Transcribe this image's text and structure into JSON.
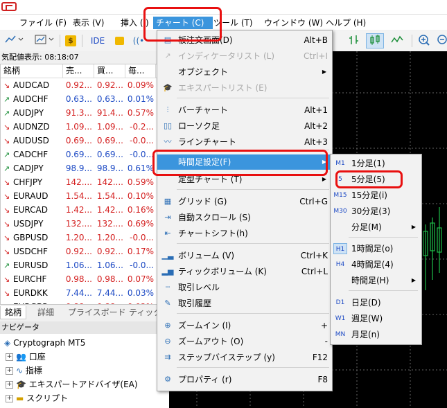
{
  "menubar": {
    "items": [
      {
        "label": "ファイル (F)"
      },
      {
        "label": "表示 (V)"
      },
      {
        "label": "挿入 (I)"
      },
      {
        "label": "チャート (C)"
      },
      {
        "label": "ツール (T)"
      },
      {
        "label": "ウインドウ (W)"
      },
      {
        "label": "ヘルプ (H)"
      }
    ]
  },
  "toolbar": {
    "ide_label": "IDE"
  },
  "market_watch": {
    "header": "気配値表示: 08:18:07",
    "columns": [
      "銘柄",
      "売...",
      "買...",
      "毎..."
    ],
    "rows": [
      {
        "dir": "down",
        "symbol": "AUDCAD",
        "bid": "0.92...",
        "ask": "0.92...",
        "change": "0.09%",
        "color": "red"
      },
      {
        "dir": "up",
        "symbol": "AUDCHF",
        "bid": "0.63...",
        "ask": "0.63...",
        "change": "0.01%",
        "color": "blue"
      },
      {
        "dir": "up",
        "symbol": "AUDJPY",
        "bid": "91.3...",
        "ask": "91.4...",
        "change": "0.57%",
        "color": "red"
      },
      {
        "dir": "down",
        "symbol": "AUDNZD",
        "bid": "1.09...",
        "ask": "1.09...",
        "change": "-0.2...",
        "color": "red"
      },
      {
        "dir": "down",
        "symbol": "AUDUSD",
        "bid": "0.69...",
        "ask": "0.69...",
        "change": "-0.0...",
        "color": "red"
      },
      {
        "dir": "up",
        "symbol": "CADCHF",
        "bid": "0.69...",
        "ask": "0.69...",
        "change": "-0.0...",
        "color": "blue"
      },
      {
        "dir": "up",
        "symbol": "CADJPY",
        "bid": "98.9...",
        "ask": "98.9...",
        "change": "0.61%",
        "color": "blue"
      },
      {
        "dir": "down",
        "symbol": "CHFJPY",
        "bid": "142....",
        "ask": "142....",
        "change": "0.59%",
        "color": "red"
      },
      {
        "dir": "down",
        "symbol": "EURAUD",
        "bid": "1.54...",
        "ask": "1.54...",
        "change": "0.10%",
        "color": "red"
      },
      {
        "dir": "down",
        "symbol": "EURCAD",
        "bid": "1.42...",
        "ask": "1.42...",
        "change": "0.16%",
        "color": "red"
      },
      {
        "dir": "down",
        "symbol": "USDJPY",
        "bid": "132....",
        "ask": "132....",
        "change": "0.69%",
        "color": "red"
      },
      {
        "dir": "down",
        "symbol": "GBPUSD",
        "bid": "1.20...",
        "ask": "1.20...",
        "change": "-0.0...",
        "color": "red"
      },
      {
        "dir": "down",
        "symbol": "USDCHF",
        "bid": "0.92...",
        "ask": "0.92...",
        "change": "0.17%",
        "color": "red"
      },
      {
        "dir": "up",
        "symbol": "EURUSD",
        "bid": "1.06...",
        "ask": "1.06...",
        "change": "-0.0...",
        "color": "blue"
      },
      {
        "dir": "down",
        "symbol": "EURCHF",
        "bid": "0.98...",
        "ask": "0.98...",
        "change": "0.07%",
        "color": "red"
      },
      {
        "dir": "down",
        "symbol": "EURDKK",
        "bid": "7.44...",
        "ask": "7.44...",
        "change": "0.03%",
        "color": "blue"
      },
      {
        "dir": "down",
        "symbol": "EURGBP",
        "bid": "0.88...",
        "ask": "0.88...",
        "change": "0.02%",
        "color": "red"
      }
    ],
    "tabs": [
      "銘柄",
      "詳細",
      "プライスボード",
      "ティック"
    ]
  },
  "navigator": {
    "header": "ナビゲータ",
    "root": "Cryptograph MT5",
    "items": [
      "口座",
      "指標",
      "エキスパートアドバイザ(EA)",
      "スクリプト"
    ]
  },
  "chart_menu": {
    "items": [
      {
        "label": "板注文画面(D)",
        "shortcut": "Alt+B",
        "icon": "depth-of-market-icon",
        "disabled": false
      },
      {
        "label": "インディケータリスト (L)",
        "shortcut": "Ctrl+I",
        "icon": "indicators-list-icon",
        "disabled": true
      },
      {
        "label": "オブジェクト",
        "shortcut": "",
        "icon": "",
        "disabled": false,
        "submenu": true
      },
      {
        "label": "エキスパートリスト (E)",
        "shortcut": "",
        "icon": "experts-list-icon",
        "disabled": true
      },
      {
        "label": "バーチャート",
        "shortcut": "Alt+1",
        "icon": "bar-chart-icon",
        "disabled": false
      },
      {
        "label": "ローソク足",
        "shortcut": "Alt+2",
        "icon": "candlestick-icon",
        "disabled": false
      },
      {
        "label": "ラインチャート",
        "shortcut": "Alt+3",
        "icon": "line-chart-icon",
        "disabled": false
      },
      {
        "label": "時間足設定(F)",
        "shortcut": "",
        "icon": "",
        "disabled": false,
        "submenu": true,
        "highlighted": true
      },
      {
        "label": "定型チャート (T)",
        "shortcut": "",
        "icon": "",
        "disabled": false,
        "submenu": true
      },
      {
        "label": "グリッド (G)",
        "shortcut": "Ctrl+G",
        "icon": "grid-icon",
        "disabled": false
      },
      {
        "label": "自動スクロール (S)",
        "shortcut": "",
        "icon": "auto-scroll-icon",
        "disabled": false
      },
      {
        "label": "チャートシフト(h)",
        "shortcut": "",
        "icon": "chart-shift-icon",
        "disabled": false
      },
      {
        "label": "ボリューム (V)",
        "shortcut": "Ctrl+K",
        "icon": "volume-icon",
        "disabled": false
      },
      {
        "label": "ティックボリューム (K)",
        "shortcut": "Ctrl+L",
        "icon": "tick-volume-icon",
        "disabled": false
      },
      {
        "label": "取引レベル",
        "shortcut": "",
        "icon": "trade-levels-icon",
        "disabled": false
      },
      {
        "label": "取引履歴",
        "shortcut": "",
        "icon": "trade-history-icon",
        "disabled": false
      },
      {
        "label": "ズームイン (I)",
        "shortcut": "+",
        "icon": "zoom-in-icon",
        "disabled": false
      },
      {
        "label": "ズームアウト (O)",
        "shortcut": "-",
        "icon": "zoom-out-icon",
        "disabled": false
      },
      {
        "label": "ステップバイステップ (y)",
        "shortcut": "F12",
        "icon": "step-by-step-icon",
        "disabled": false
      },
      {
        "label": "プロパティ (r)",
        "shortcut": "F8",
        "icon": "properties-gear-icon",
        "disabled": false
      }
    ]
  },
  "timeframe_menu": {
    "items": [
      {
        "tag": "M1",
        "label": "1分足(1)"
      },
      {
        "tag": "5",
        "label": "5分足(5)",
        "selected": true
      },
      {
        "tag": "M15",
        "label": "15分足(i)"
      },
      {
        "tag": "M30",
        "label": "30分足(3)"
      },
      {
        "tag": "",
        "label": "分足(M)",
        "submenu": true
      },
      {
        "tag": "H1",
        "label": "1時間足(o)",
        "checked": true
      },
      {
        "tag": "H4",
        "label": "4時間足(4)"
      },
      {
        "tag": "",
        "label": "時間足(H)",
        "submenu": true
      },
      {
        "tag": "D1",
        "label": "日足(D)"
      },
      {
        "tag": "W1",
        "label": "週足(W)"
      },
      {
        "tag": "MN",
        "label": "月足(n)"
      }
    ]
  }
}
